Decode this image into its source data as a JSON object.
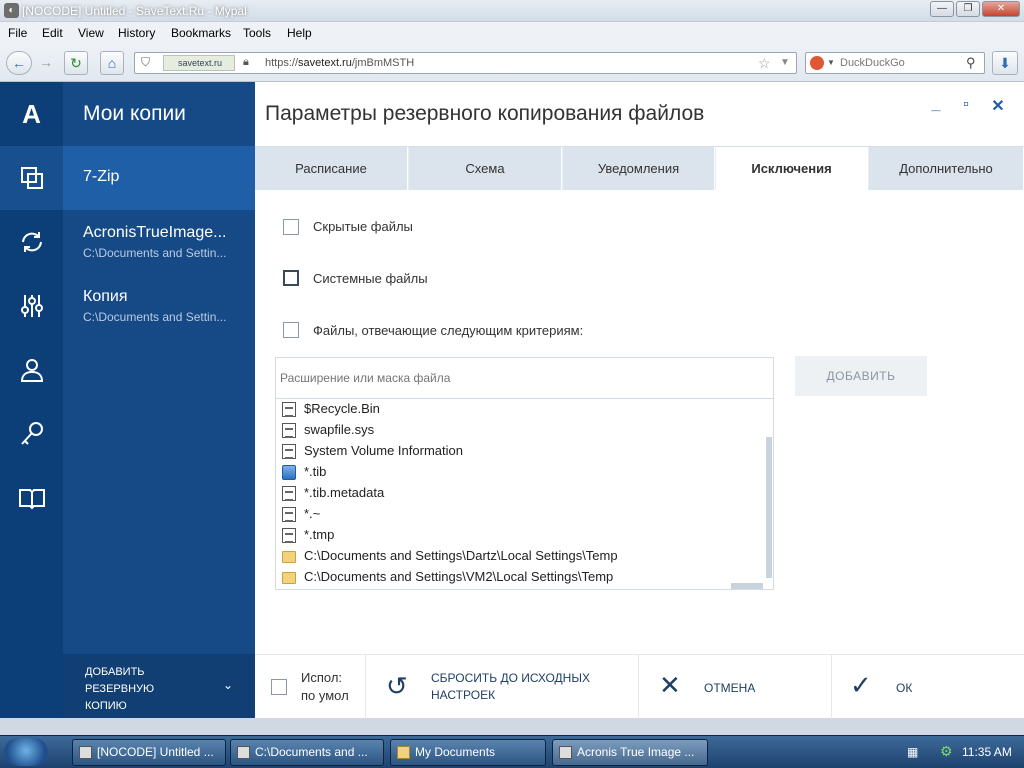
{
  "browser": {
    "window_title": "[NOCODE] Untitled - SaveText.Ru - Mypal",
    "menu": [
      "File",
      "Edit",
      "View",
      "History",
      "Bookmarks",
      "Tools",
      "Help"
    ],
    "site_badge": "savetext.ru",
    "url_prefix": "https://",
    "url_host": "savetext.ru",
    "url_path": "/jmBmMSTH",
    "search_placeholder": "DuckDuckGo"
  },
  "rail": {
    "logo": "A",
    "icons": [
      "logo-icon",
      "backups-icon",
      "sync-icon",
      "tools-icon",
      "account-icon",
      "key-icon",
      "book-icon"
    ]
  },
  "sidebar": {
    "title": "Мои копии",
    "items": [
      {
        "title": "7-Zip",
        "subtitle": ""
      },
      {
        "title": "AcronisTrueImage...",
        "subtitle": "C:\\Documents and Settin..."
      },
      {
        "title": "Копия",
        "subtitle": "C:\\Documents and Settin..."
      }
    ],
    "add_backup_label": "ДОБАВИТЬ РЕЗЕРВНУЮ КОПИЮ"
  },
  "main": {
    "title": "Параметры резервного копирования файлов",
    "tabs": [
      "Расписание",
      "Схема",
      "Уведомления",
      "Исключения",
      "Дополнительно"
    ],
    "active_tab": "Исключения",
    "checks": [
      {
        "label": "Скрытые файлы",
        "checked": false
      },
      {
        "label": "Системные файлы",
        "checked": false
      },
      {
        "label": "Файлы, отвечающие следующим критериям:",
        "checked": false
      }
    ],
    "mask_placeholder": "Расширение или маска файла",
    "add_label": "ДОБАВИТЬ",
    "exclusions": [
      {
        "name": "$Recycle.Bin",
        "icon": "doc"
      },
      {
        "name": "swapfile.sys",
        "icon": "doc"
      },
      {
        "name": "System Volume Information",
        "icon": "doc"
      },
      {
        "name": "*.tib",
        "icon": "blue"
      },
      {
        "name": "*.tib.metadata",
        "icon": "doc"
      },
      {
        "name": "*.~",
        "icon": "doc"
      },
      {
        "name": "*.tmp",
        "icon": "doc"
      },
      {
        "name": "C:\\Documents and Settings\\Dartz\\Local Settings\\Temp",
        "icon": "folder"
      },
      {
        "name": "C:\\Documents and Settings\\VM2\\Local Settings\\Temp",
        "icon": "folder"
      }
    ],
    "footer": {
      "default_label_1": "Испол:",
      "default_label_2": "по умол",
      "reset_label_1": "СБРОСИТЬ ДО ИСХОДНЫХ",
      "reset_label_2": "НАСТРОЕК",
      "cancel_label": "ОТМЕНА",
      "ok_label": "ОК"
    }
  },
  "taskbar": {
    "tasks": [
      {
        "label": "[NOCODE] Untitled ..."
      },
      {
        "label": "C:\\Documents and ..."
      },
      {
        "label": "My Documents"
      },
      {
        "label": "Acronis True Image ..."
      }
    ],
    "clock": "11:35 AM"
  },
  "colors": {
    "rail_bg": "#0c3f78",
    "sidebar_bg": "#164a87",
    "sidebar_active": "#1f5fa8",
    "accent": "#1e5ea6"
  }
}
